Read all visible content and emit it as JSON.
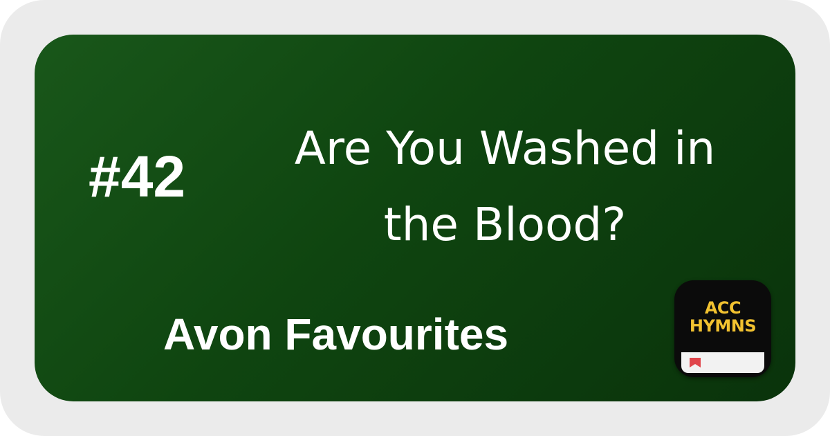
{
  "hymn": {
    "number": "#42",
    "title": "Are You Washed in\nthe Blood?",
    "collection": "Avon Favourites"
  },
  "app_icon": {
    "line1": "ACC",
    "line2": "HYMNS",
    "text_color": "#f2c230",
    "ribbon_color": "#e0454b"
  },
  "colors": {
    "card_background": "#114d12",
    "frame_background": "#ebebeb",
    "text": "#ffffff"
  }
}
